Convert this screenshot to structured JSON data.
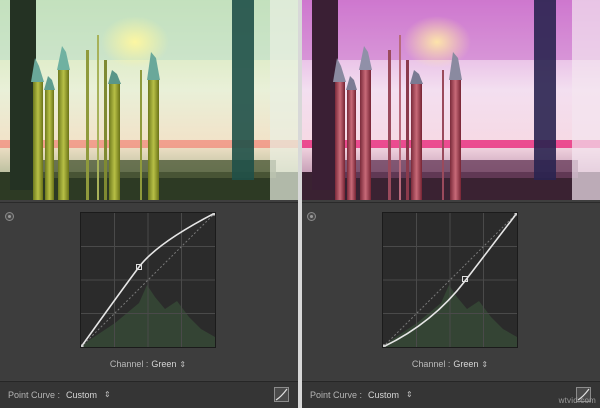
{
  "left_panel": {
    "channel_label": "Channel :",
    "channel_value": "Green",
    "point_curve_label": "Point Curve :",
    "point_curve_value": "Custom"
  },
  "right_panel": {
    "channel_label": "Channel :",
    "channel_value": "Green",
    "point_curve_label": "Point Curve :",
    "point_curve_value": "Custom"
  },
  "watermark": "wtvid.com",
  "icons": {
    "panel_toggle": "circle-toggle-icon",
    "dropdown_arrows": "up-down-arrows-icon",
    "targeted_adjustment": "curve-adjust-icon"
  },
  "colors": {
    "panel_bg": "#3d3d3d",
    "graph_bg": "#2b2b2b",
    "curve": "#e6e6e6"
  }
}
